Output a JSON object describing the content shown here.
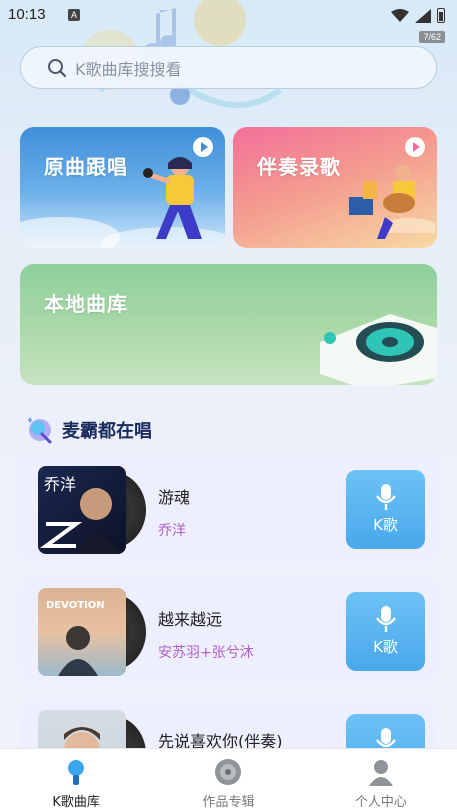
{
  "status_bar": {
    "time": "10:13",
    "notification": "A",
    "version": "7/62"
  },
  "search": {
    "placeholder": "K歌曲库搜搜看"
  },
  "cards": [
    {
      "title": "原曲跟唱",
      "accent": "#3f8fd8"
    },
    {
      "title": "伴奏录歌",
      "accent": "#f2709a"
    },
    {
      "title": "本地曲库",
      "accent": "#8ed09d"
    }
  ],
  "section": {
    "title": "麦霸都在唱"
  },
  "songs": [
    {
      "title": "游魂",
      "artist": "乔洋",
      "cover_text": "乔洋",
      "button": "K歌"
    },
    {
      "title": "越来越远",
      "artist": "安苏羽+张兮沐",
      "cover_text": "DEVOTION",
      "button": "K歌"
    },
    {
      "title": "先说喜欢你(伴奏)",
      "artist": "",
      "cover_text": "",
      "button": "K歌"
    }
  ],
  "tabbar": {
    "items": [
      {
        "label": "K歌曲库",
        "icon": "mic-icon",
        "active": true
      },
      {
        "label": "作品专辑",
        "icon": "disc-icon",
        "active": false
      },
      {
        "label": "个人中心",
        "icon": "user-icon",
        "active": false
      }
    ]
  },
  "colors": {
    "accent_blue": "#49a8ea",
    "artist_purple": "#b05ec9",
    "title_navy": "#1c2b5e"
  }
}
